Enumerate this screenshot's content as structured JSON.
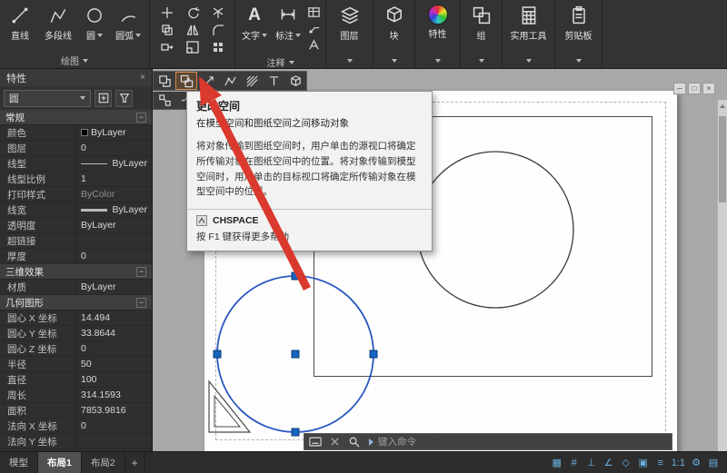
{
  "glyphs": {
    "minus": "−",
    "close": "×",
    "win_min": "─",
    "win_restore": "□",
    "win_close": "×"
  },
  "ribbon": {
    "draw": {
      "label": "绘图",
      "buttons": [
        "直线",
        "多段线",
        "圆",
        "圆弧"
      ]
    },
    "annotate": {
      "label": "注释",
      "text_label": "文字",
      "dim_label": "标注",
      "text_glyph": "A"
    },
    "panels_right": [
      {
        "label": "图层"
      },
      {
        "label": "块"
      },
      {
        "label": "特性"
      },
      {
        "label": "组"
      },
      {
        "label": "实用工具"
      },
      {
        "label": "剪贴板"
      }
    ]
  },
  "tooltip": {
    "title": "更改空间",
    "summary": "在模型空间和图纸空间之间移动对象",
    "body": "将对象传输到图纸空间时，用户单击的源视口将确定所传输对象在图纸空间中的位置。将对象传输到模型空间时，用户单击的目标视口将确定所传输对象在模型空间中的位置。",
    "command": "CHSPACE",
    "help": "按 F1 键获得更多帮助"
  },
  "properties": {
    "title": "特性",
    "selector": "圆",
    "sections": [
      {
        "header": "常规",
        "rows": [
          [
            "颜色",
            "ByLayer"
          ],
          [
            "图层",
            "0"
          ],
          [
            "线型",
            "ByLayer"
          ],
          [
            "线型比例",
            "1"
          ],
          [
            "打印样式",
            "ByColor"
          ],
          [
            "线宽",
            "ByLayer"
          ],
          [
            "透明度",
            "ByLayer"
          ],
          [
            "超链接",
            ""
          ],
          [
            "厚度",
            "0"
          ]
        ]
      },
      {
        "header": "三维效果",
        "rows": [
          [
            "材质",
            "ByLayer"
          ]
        ]
      },
      {
        "header": "几何图形",
        "rows": [
          [
            "圆心 X 坐标",
            "14.494"
          ],
          [
            "圆心 Y 坐标",
            "33.8644"
          ],
          [
            "圆心 Z 坐标",
            "0"
          ],
          [
            "半径",
            "50"
          ],
          [
            "直径",
            "100"
          ],
          [
            "周长",
            "314.1593"
          ],
          [
            "面积",
            "7853.9816"
          ],
          [
            "法向 X 坐标",
            "0"
          ],
          [
            "法向 Y 坐标",
            ""
          ]
        ]
      }
    ]
  },
  "command": {
    "placeholder": "键入命令"
  },
  "tabs": {
    "items": [
      {
        "label": "模型"
      },
      {
        "label": "布局1"
      },
      {
        "label": "布局2"
      }
    ],
    "add": "+"
  },
  "status": {
    "icons": [
      {
        "name": "snap-grid",
        "glyph": "▦"
      },
      {
        "name": "grid-display",
        "glyph": "#"
      },
      {
        "name": "ortho-mode",
        "glyph": "⊥"
      },
      {
        "name": "polar-tracking",
        "glyph": "∠"
      },
      {
        "name": "isodraft",
        "glyph": "◇"
      },
      {
        "name": "object-snap",
        "glyph": "▣"
      },
      {
        "name": "lineweight-display",
        "glyph": "≡"
      },
      {
        "name": "annotation-scale",
        "glyph": "1:1"
      },
      {
        "name": "workspace-switching",
        "glyph": "⚙"
      },
      {
        "name": "customize",
        "glyph": "▤"
      }
    ]
  }
}
